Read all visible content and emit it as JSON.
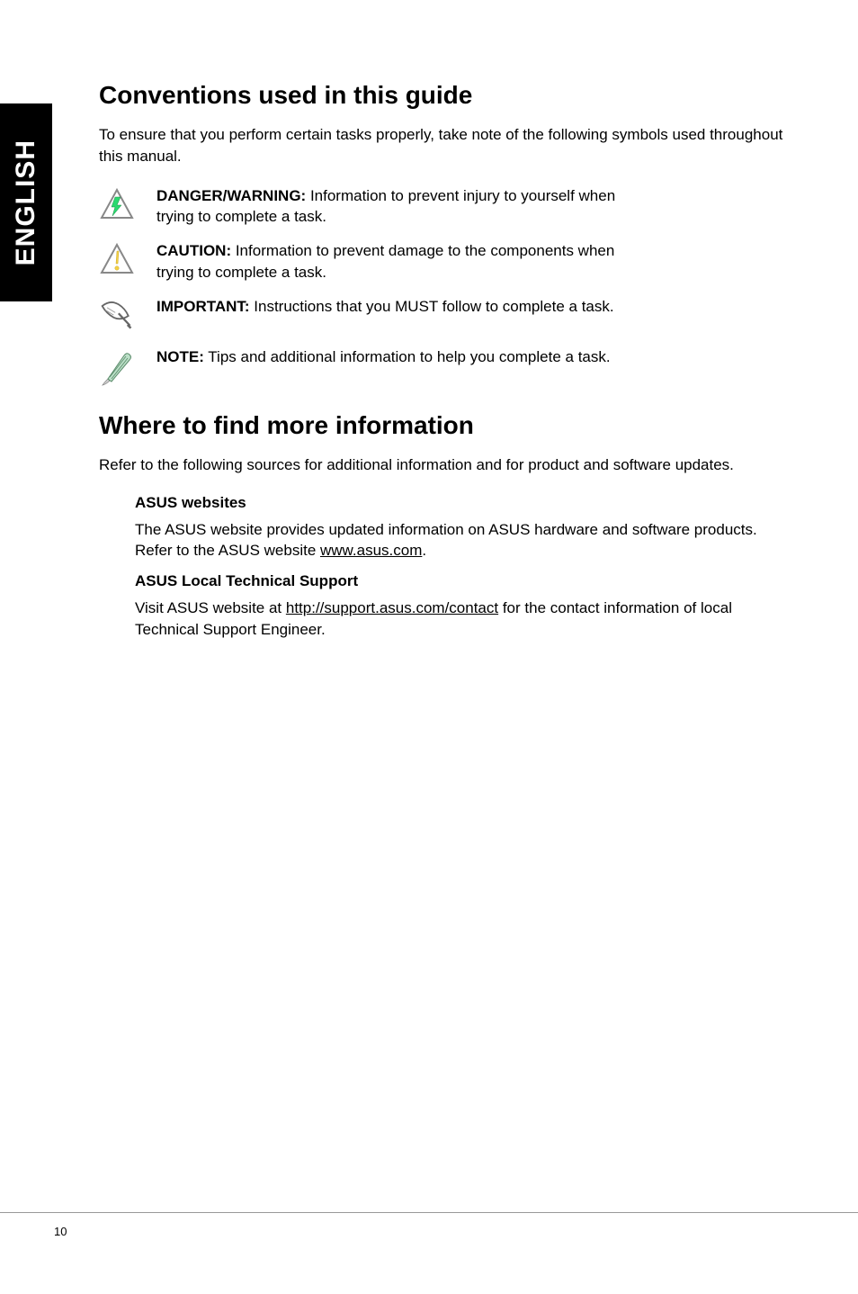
{
  "sideTab": "ENGLISH",
  "section1": {
    "heading": "Conventions used in this guide",
    "intro": "To ensure that you perform certain tasks properly, take note of the following symbols used throughout this manual.",
    "danger": {
      "label": "DANGER/WARNING:",
      "text": "  Information to prevent injury to yourself when trying to complete a task."
    },
    "caution": {
      "label": "CAUTION:",
      "text": " Information to prevent damage to the components when trying to complete a task."
    },
    "important": {
      "label": "IMPORTANT:",
      "text": " Instructions that you MUST follow to complete a task."
    },
    "note": {
      "label": "NOTE:",
      "text": " Tips and additional information to help you complete a task."
    }
  },
  "section2": {
    "heading": "Where to find more information",
    "intro": "Refer to the following sources for additional information and for product and software updates.",
    "asusWebsites": {
      "heading": "ASUS websites",
      "text_before": "The ASUS website provides updated information on ASUS hardware and software products. Refer to the ASUS website ",
      "link": "www.asus.com",
      "text_after": "."
    },
    "localSupport": {
      "heading": "ASUS Local Technical Support",
      "text_before": "Visit ASUS website at ",
      "link": "http://support.asus.com/contact",
      "text_after": " for the contact information of local Technical Support Engineer."
    }
  },
  "pageNumber": "10"
}
